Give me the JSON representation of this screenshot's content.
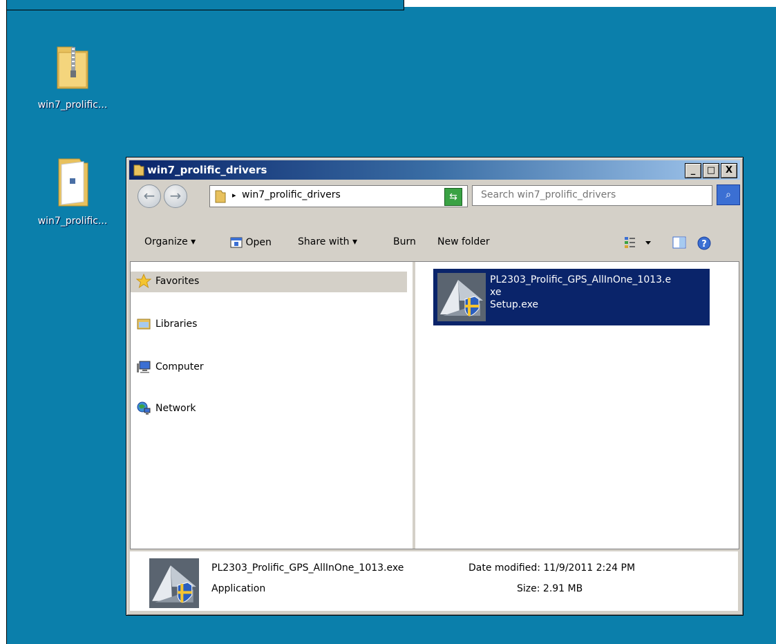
{
  "desktop": {
    "icons": [
      {
        "label": "win7_prolific...",
        "icon": "zip-folder-icon"
      },
      {
        "label": "win7_prolific...",
        "icon": "folder-icon"
      }
    ]
  },
  "window": {
    "title": "win7_prolific_drivers",
    "controls": {
      "minimize": "_",
      "maximize": "□",
      "close": "X"
    },
    "address": {
      "path": "win7_prolific_drivers",
      "separator": "▸",
      "dropdown": "▾"
    },
    "search": {
      "placeholder": "Search win7_prolific_drivers"
    },
    "toolbar": {
      "organize": "Organize ▾",
      "open": "Open",
      "share_with": "Share with ▾",
      "burn": "Burn",
      "new_folder": "New folder"
    },
    "nav": {
      "favorites": "Favorites",
      "libraries": "Libraries",
      "computer": "Computer",
      "network": "Network"
    },
    "file": {
      "name_line1": "PL2303_Prolific_GPS_AllInOne_1013.e",
      "name_line2": "xe",
      "description": "Setup.exe"
    },
    "details": {
      "filename": "PL2303_Prolific_GPS_AllInOne_1013.exe",
      "type": "Application",
      "date_modified": "Date modified: 11/9/2011 2:24 PM",
      "size": "Size: 2.91 MB"
    }
  }
}
